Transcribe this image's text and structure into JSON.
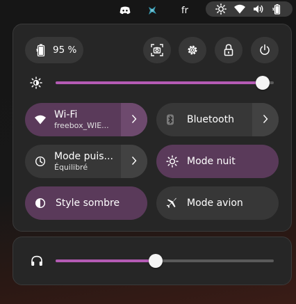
{
  "topbar": {
    "icons": [
      "discord-icon",
      "app-tray-icon"
    ],
    "lang": "fr",
    "tray_icons": [
      "brightness-icon",
      "wifi-icon",
      "volume-icon",
      "battery-icon"
    ]
  },
  "header": {
    "battery_percent": "95 %",
    "buttons": [
      "screenshot-icon",
      "settings-icon",
      "lock-icon",
      "power-icon"
    ]
  },
  "brightness": {
    "level": 0.95
  },
  "tiles": {
    "wifi": {
      "label": "Wi-Fi",
      "sub": "freebox_WIE...",
      "active": true
    },
    "bluetooth": {
      "label": "Bluetooth",
      "active": false
    },
    "power_mode": {
      "label": "Mode puis...",
      "sub": "Équilibré",
      "active": false
    },
    "night": {
      "label": "Mode nuit",
      "active": true
    },
    "dark": {
      "label": "Style sombre",
      "active": true
    },
    "airplane": {
      "label": "Mode avion",
      "active": false
    }
  },
  "volume": {
    "level": 0.46
  },
  "colors": {
    "accent": "#b45bb4",
    "tile_active": "#5a3a5a",
    "tile": "#373737",
    "panel": "#262626"
  }
}
